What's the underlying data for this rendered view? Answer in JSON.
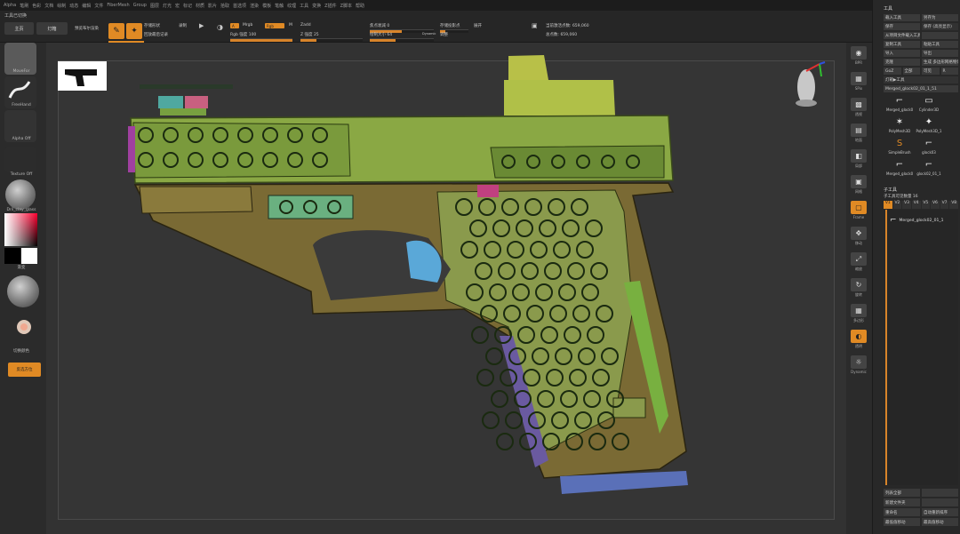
{
  "menu": [
    "Alpha",
    "笔刷",
    "色彩",
    "文档",
    "绘制",
    "动态",
    "编辑",
    "文件",
    "FiberMesh",
    "Group",
    "图层",
    "灯光",
    "宏",
    "标记",
    "材质",
    "影片",
    "拾取",
    "首选项",
    "渲染",
    "模板",
    "笔触",
    "纹理",
    "工具",
    "变换",
    "Z插件",
    "Z脚本",
    "帮助"
  ],
  "toolbar": {
    "title": "工具已切换",
    "home_label": "主页",
    "lightbox_label": "灯箱",
    "preview_label": "预览布尔渲染",
    "edit_label": "编辑",
    "draw_label": "绘制",
    "store_mt": "存储形状",
    "record": "录制",
    "mrgb": "Mrgb",
    "rgb": "Rgb",
    "m": "M",
    "rgb_intensity_label": "Rgb 强度 100",
    "zadd": "Zadd",
    "zsub": "Zsub",
    "z_intensity_label": "Z 强度 25",
    "focal_label": "焦点衰减 0",
    "draw_size_label": "绘制大小 64",
    "dynamic": "Dynamic",
    "store_projection": "存储投影点",
    "subdiv": "展开",
    "active_points": "当前激活点数: 659,060",
    "total_points": "总点数: 659,060",
    "adjust_label": "调整",
    "replay_label": "回放最后记录"
  },
  "left_panel": {
    "brush1": "MoveFor",
    "brush2": "FreeHand",
    "alpha": "Alpha Off",
    "texture": "Texture Off",
    "material": "Dril_clay_glass",
    "gradient": "渐变",
    "switch_color": "切换颜色",
    "btn": "反选方位"
  },
  "right_panel": {
    "title": "工具",
    "rows": [
      [
        "载入工具",
        "另存为"
      ],
      [
        "保存",
        "保存 (高亮显示)"
      ],
      [
        "从项目文件载入工具",
        ""
      ],
      [
        "复制工具",
        "粘贴工具"
      ],
      [
        "导入",
        "导出"
      ],
      [
        "克隆",
        "生成 多边形网格物体"
      ],
      [
        "GoZ",
        "全部",
        "可见",
        "R"
      ]
    ],
    "lightbox_tools": "灯箱▶工具",
    "current_tool": "Merged_glock02_01_1_51",
    "tools": [
      "Merged_glock0",
      "Cylinder3D",
      "PolyMesh3D",
      "PolyMesh3D_1",
      "SimpleBrush",
      "glock03",
      "Merged_glock0",
      "glock02_01_1"
    ],
    "subtool_title": "子工具",
    "subtool_count": "子工具可见数量 16",
    "vtabs": [
      "V1",
      "V2",
      "V3",
      "V4",
      "V5",
      "V6",
      "V7",
      "V8"
    ],
    "subtool_item": "Merged_glock02_01_1",
    "bottom_rows": [
      [
        "列表全部",
        ""
      ],
      [
        "新建文件夹",
        ""
      ],
      [
        "重命名",
        "自动重新排序"
      ],
      [
        "最低值移动",
        "最高值移动"
      ]
    ]
  },
  "icon_strip": [
    "BPR",
    "SPix",
    "透视",
    "地面",
    "局部",
    "网格",
    "Frame",
    "移动",
    "缩放",
    "旋转",
    "多边形",
    "透明",
    "Dynamic"
  ]
}
